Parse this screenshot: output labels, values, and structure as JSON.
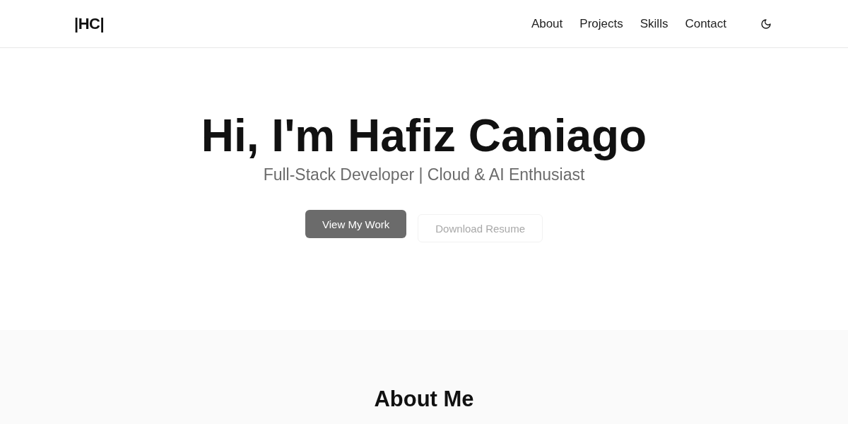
{
  "header": {
    "logo": "|HC|",
    "nav": [
      {
        "label": "About"
      },
      {
        "label": "Projects"
      },
      {
        "label": "Skills"
      },
      {
        "label": "Contact"
      }
    ]
  },
  "hero": {
    "title": "Hi, I'm Hafiz Caniago",
    "subtitle": "Full-Stack Developer | Cloud & AI Enthusiast",
    "buttons": [
      {
        "label": "View My Work",
        "kind": "primary"
      },
      {
        "label": "Download Resume",
        "kind": "faded"
      }
    ]
  },
  "about": {
    "title": "About Me"
  }
}
